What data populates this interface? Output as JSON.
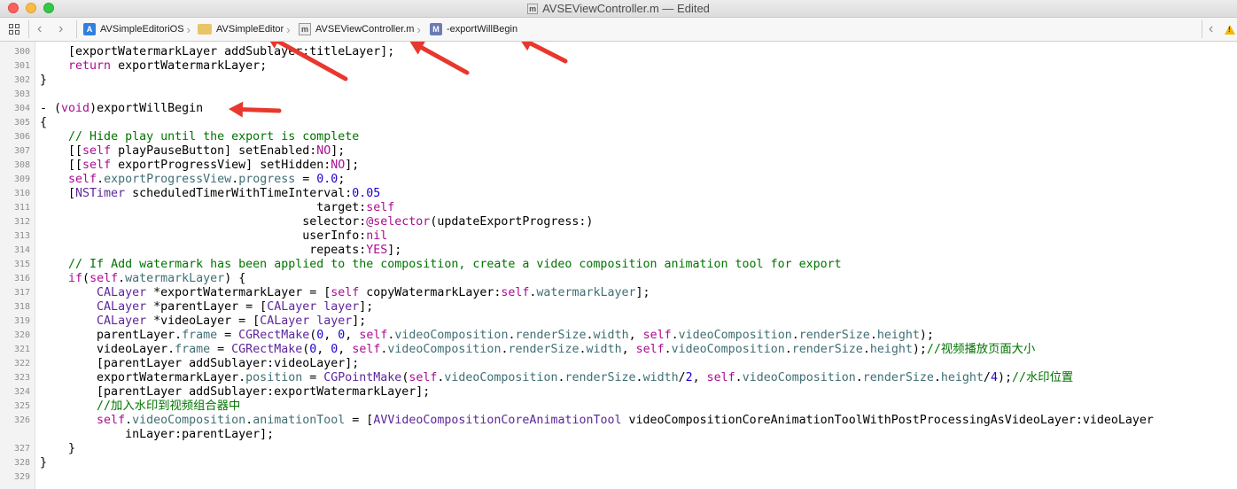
{
  "window": {
    "title": "AVSEViewController.m — Edited",
    "title_icon_letter": "m"
  },
  "jumpbar": {
    "crumbs": [
      {
        "label": "AVSimpleEditoriOS",
        "icon": "project-icon"
      },
      {
        "label": "AVSimpleEditor",
        "icon": "folder-icon"
      },
      {
        "label": "AVSEViewController.m",
        "icon": "objc-file-icon",
        "icon_letter": "m"
      },
      {
        "label": "-exportWillBegin",
        "icon": "method-icon",
        "icon_letter": "M"
      }
    ]
  },
  "colors": {
    "keyword": "#aa0d91",
    "comment": "#007400",
    "number": "#1c00cf",
    "class": "#5c2699",
    "property": "#3f6e74",
    "annotation_arrow": "#e8382d"
  },
  "editor": {
    "lines": [
      {
        "n": "300",
        "segs": [
          [
            "",
            "    [exportWatermarkLayer addSublayer:titleLayer];"
          ]
        ]
      },
      {
        "n": "301",
        "segs": [
          [
            "",
            "    "
          ],
          [
            "kw",
            "return"
          ],
          [
            "",
            " exportWatermarkLayer;"
          ]
        ]
      },
      {
        "n": "302",
        "segs": [
          [
            "",
            "}"
          ]
        ]
      },
      {
        "n": "303",
        "segs": [
          [
            "",
            ""
          ]
        ]
      },
      {
        "n": "304",
        "segs": [
          [
            "",
            "- ("
          ],
          [
            "kw",
            "void"
          ],
          [
            "",
            ")exportWillBegin"
          ]
        ]
      },
      {
        "n": "305",
        "segs": [
          [
            "",
            "{"
          ]
        ]
      },
      {
        "n": "306",
        "segs": [
          [
            "",
            "    "
          ],
          [
            "cm",
            "// Hide play until the export is complete"
          ]
        ]
      },
      {
        "n": "307",
        "segs": [
          [
            "",
            "    [["
          ],
          [
            "kw",
            "self"
          ],
          [
            "",
            " playPauseButton] setEnabled:"
          ],
          [
            "kw",
            "NO"
          ],
          [
            "",
            "];"
          ]
        ]
      },
      {
        "n": "308",
        "segs": [
          [
            "",
            "    [["
          ],
          [
            "kw",
            "self"
          ],
          [
            "",
            " exportProgressView] setHidden:"
          ],
          [
            "kw",
            "NO"
          ],
          [
            "",
            "];"
          ]
        ]
      },
      {
        "n": "309",
        "segs": [
          [
            "",
            "    "
          ],
          [
            "kw",
            "self"
          ],
          [
            "",
            "."
          ],
          [
            "prop",
            "exportProgressView"
          ],
          [
            "",
            "."
          ],
          [
            "prop",
            "progress"
          ],
          [
            "",
            " = "
          ],
          [
            "num",
            "0.0"
          ],
          [
            "",
            ";"
          ]
        ]
      },
      {
        "n": "310",
        "segs": [
          [
            "",
            "    ["
          ],
          [
            "cls",
            "NSTimer"
          ],
          [
            "",
            " scheduledTimerWithTimeInterval:"
          ],
          [
            "num",
            "0.05"
          ]
        ]
      },
      {
        "n": "311",
        "segs": [
          [
            "",
            "                                       target:"
          ],
          [
            "kw",
            "self"
          ]
        ]
      },
      {
        "n": "312",
        "segs": [
          [
            "",
            "                                     selector:"
          ],
          [
            "kw",
            "@selector"
          ],
          [
            "",
            "(updateExportProgress:)"
          ]
        ]
      },
      {
        "n": "313",
        "segs": [
          [
            "",
            "                                     userInfo:"
          ],
          [
            "kw",
            "nil"
          ]
        ]
      },
      {
        "n": "314",
        "segs": [
          [
            "",
            "                                      repeats:"
          ],
          [
            "kw",
            "YES"
          ],
          [
            "",
            "];"
          ]
        ]
      },
      {
        "n": "315",
        "segs": [
          [
            "",
            "    "
          ],
          [
            "cm",
            "// If Add watermark has been applied to the composition, create a video composition animation tool for export"
          ]
        ]
      },
      {
        "n": "316",
        "segs": [
          [
            "",
            "    "
          ],
          [
            "kw",
            "if"
          ],
          [
            "",
            "("
          ],
          [
            "kw",
            "self"
          ],
          [
            "",
            "."
          ],
          [
            "prop",
            "watermarkLayer"
          ],
          [
            "",
            ") {"
          ]
        ]
      },
      {
        "n": "317",
        "segs": [
          [
            "",
            "        "
          ],
          [
            "cls",
            "CALayer"
          ],
          [
            "",
            " *exportWatermarkLayer = ["
          ],
          [
            "kw",
            "self"
          ],
          [
            "",
            " copyWatermarkLayer:"
          ],
          [
            "kw",
            "self"
          ],
          [
            "",
            "."
          ],
          [
            "prop",
            "watermarkLayer"
          ],
          [
            "",
            "];"
          ]
        ]
      },
      {
        "n": "318",
        "segs": [
          [
            "",
            "        "
          ],
          [
            "cls",
            "CALayer"
          ],
          [
            "",
            " *parentLayer = ["
          ],
          [
            "cls",
            "CALayer"
          ],
          [
            "",
            " "
          ],
          [
            "cls",
            "layer"
          ],
          [
            "",
            "];"
          ]
        ]
      },
      {
        "n": "319",
        "segs": [
          [
            "",
            "        "
          ],
          [
            "cls",
            "CALayer"
          ],
          [
            "",
            " *videoLayer = ["
          ],
          [
            "cls",
            "CALayer"
          ],
          [
            "",
            " "
          ],
          [
            "cls",
            "layer"
          ],
          [
            "",
            "];"
          ]
        ]
      },
      {
        "n": "320",
        "segs": [
          [
            "",
            "        parentLayer."
          ],
          [
            "prop",
            "frame"
          ],
          [
            "",
            " = "
          ],
          [
            "cls",
            "CGRectMake"
          ],
          [
            "",
            "("
          ],
          [
            "num",
            "0"
          ],
          [
            "",
            ", "
          ],
          [
            "num",
            "0"
          ],
          [
            "",
            ", "
          ],
          [
            "kw",
            "self"
          ],
          [
            "",
            "."
          ],
          [
            "prop",
            "videoComposition"
          ],
          [
            "",
            "."
          ],
          [
            "prop",
            "renderSize"
          ],
          [
            "",
            "."
          ],
          [
            "prop",
            "width"
          ],
          [
            "",
            ", "
          ],
          [
            "kw",
            "self"
          ],
          [
            "",
            "."
          ],
          [
            "prop",
            "videoComposition"
          ],
          [
            "",
            "."
          ],
          [
            "prop",
            "renderSize"
          ],
          [
            "",
            "."
          ],
          [
            "prop",
            "height"
          ],
          [
            "",
            ");"
          ]
        ]
      },
      {
        "n": "321",
        "segs": [
          [
            "",
            "        videoLayer."
          ],
          [
            "prop",
            "frame"
          ],
          [
            "",
            " = "
          ],
          [
            "cls",
            "CGRectMake"
          ],
          [
            "",
            "("
          ],
          [
            "num",
            "0"
          ],
          [
            "",
            ", "
          ],
          [
            "num",
            "0"
          ],
          [
            "",
            ", "
          ],
          [
            "kw",
            "self"
          ],
          [
            "",
            "."
          ],
          [
            "prop",
            "videoComposition"
          ],
          [
            "",
            "."
          ],
          [
            "prop",
            "renderSize"
          ],
          [
            "",
            "."
          ],
          [
            "prop",
            "width"
          ],
          [
            "",
            ", "
          ],
          [
            "kw",
            "self"
          ],
          [
            "",
            "."
          ],
          [
            "prop",
            "videoComposition"
          ],
          [
            "",
            "."
          ],
          [
            "prop",
            "renderSize"
          ],
          [
            "",
            "."
          ],
          [
            "prop",
            "height"
          ],
          [
            "",
            ");"
          ],
          [
            "cm",
            "//视频播放页面大小"
          ]
        ]
      },
      {
        "n": "322",
        "segs": [
          [
            "",
            "        [parentLayer addSublayer:videoLayer];"
          ]
        ]
      },
      {
        "n": "323",
        "segs": [
          [
            "",
            "        exportWatermarkLayer."
          ],
          [
            "prop",
            "position"
          ],
          [
            "",
            " = "
          ],
          [
            "cls",
            "CGPointMake"
          ],
          [
            "",
            "("
          ],
          [
            "kw",
            "self"
          ],
          [
            "",
            "."
          ],
          [
            "prop",
            "videoComposition"
          ],
          [
            "",
            "."
          ],
          [
            "prop",
            "renderSize"
          ],
          [
            "",
            "."
          ],
          [
            "prop",
            "width"
          ],
          [
            "",
            "/"
          ],
          [
            "num",
            "2"
          ],
          [
            "",
            ", "
          ],
          [
            "kw",
            "self"
          ],
          [
            "",
            "."
          ],
          [
            "prop",
            "videoComposition"
          ],
          [
            "",
            "."
          ],
          [
            "prop",
            "renderSize"
          ],
          [
            "",
            "."
          ],
          [
            "prop",
            "height"
          ],
          [
            "",
            "/"
          ],
          [
            "num",
            "4"
          ],
          [
            "",
            ");"
          ],
          [
            "cm",
            "//水印位置"
          ]
        ]
      },
      {
        "n": "324",
        "segs": [
          [
            "",
            "        [parentLayer addSublayer:exportWatermarkLayer];"
          ]
        ]
      },
      {
        "n": "325",
        "segs": [
          [
            "",
            "        "
          ],
          [
            "cm",
            "//加入水印到视频组合器中"
          ]
        ]
      },
      {
        "n": "326",
        "segs": [
          [
            "",
            "        "
          ],
          [
            "kw",
            "self"
          ],
          [
            "",
            "."
          ],
          [
            "prop",
            "videoComposition"
          ],
          [
            "",
            "."
          ],
          [
            "prop",
            "animationTool"
          ],
          [
            "",
            " = ["
          ],
          [
            "cls",
            "AVVideoCompositionCoreAnimationTool"
          ],
          [
            "",
            " videoCompositionCoreAnimationToolWithPostProcessingAsVideoLayer:videoLayer"
          ]
        ]
      },
      {
        "n": "",
        "segs": [
          [
            "",
            "            inLayer:parentLayer];"
          ]
        ]
      },
      {
        "n": "327",
        "segs": [
          [
            "",
            "    }"
          ]
        ]
      },
      {
        "n": "328",
        "segs": [
          [
            "",
            "}"
          ]
        ]
      },
      {
        "n": "329",
        "segs": [
          [
            "",
            ""
          ]
        ]
      }
    ]
  }
}
